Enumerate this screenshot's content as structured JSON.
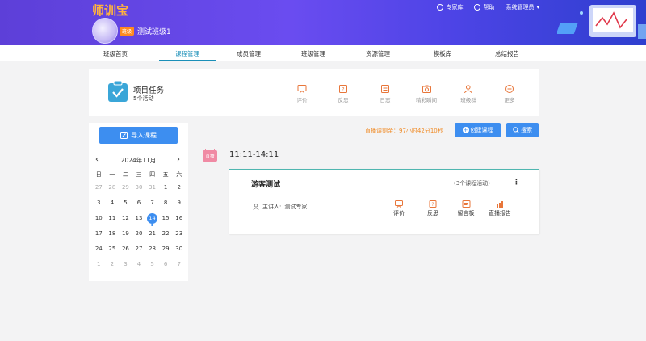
{
  "header": {
    "logo": "师训宝",
    "links": [
      "专家库",
      "帮助",
      "系统管理员"
    ],
    "class_tag": "班级",
    "class_name": "测试班级1"
  },
  "nav": {
    "tabs": [
      "班级首页",
      "课程管理",
      "成员管理",
      "班级管理",
      "资源管理",
      "模板库",
      "总结报告"
    ],
    "active": "课程管理"
  },
  "task": {
    "title": "项目任务",
    "count": "5个活动",
    "tools": [
      "评价",
      "反思",
      "日志",
      "精彩瞬间",
      "班级群",
      "更多"
    ]
  },
  "left": {
    "import_label": "导入课程",
    "calendar": {
      "title": "2024年11月",
      "weekdays": [
        "日",
        "一",
        "二",
        "三",
        "四",
        "五",
        "六"
      ],
      "selected": "14"
    }
  },
  "toolbar": {
    "remaining": "直播课剩余：97小时42分10秒",
    "create_label": "创建课程",
    "search_label": "搜索"
  },
  "session": {
    "tag": "直播",
    "time": "11:11-14:11"
  },
  "course": {
    "title": "游客测试",
    "count": "(3个课程活动)",
    "speaker_label": "主讲人:",
    "speaker_name": "测试专家",
    "actions": [
      "评价",
      "反思",
      "留言板",
      "直播报告"
    ]
  }
}
